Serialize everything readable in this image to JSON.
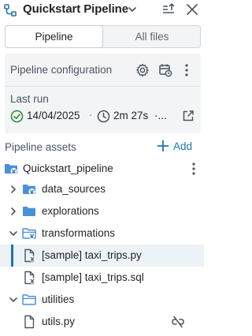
{
  "header": {
    "title": "Quickstart Pipeline",
    "icons": [
      "pipeline-icon",
      "chevron-down-icon",
      "collapse-icon",
      "close-icon"
    ]
  },
  "tabs": [
    {
      "label": "Pipeline",
      "active": true
    },
    {
      "label": "All files",
      "active": false
    }
  ],
  "config": {
    "label": "Pipeline configuration",
    "last_run_label": "Last run",
    "last_run_date": "14/04/2025",
    "separator": "·",
    "duration": "2m 27s",
    "more": "·..."
  },
  "assets": {
    "label": "Pipeline assets",
    "add_label": "Add"
  },
  "tree": {
    "root": "Quickstart_pipeline",
    "items": [
      {
        "label": "data_sources",
        "type": "folder",
        "expanded": false
      },
      {
        "label": "explorations",
        "type": "folder",
        "expanded": false
      },
      {
        "label": "transformations",
        "type": "folder",
        "expanded": true
      },
      {
        "label": "[sample] taxi_trips.py",
        "type": "file",
        "selected": true
      },
      {
        "label": "[sample] taxi_trips.sql",
        "type": "file"
      },
      {
        "label": "utilities",
        "type": "folder",
        "expanded": true
      },
      {
        "label": "utils.py",
        "type": "file"
      }
    ]
  },
  "colors": {
    "accent": "#2272b4",
    "folder": "#4a90d9",
    "success": "#2a8a3c",
    "panel_bg": "#f3f4f6",
    "selected_bg": "#edf2f7"
  }
}
